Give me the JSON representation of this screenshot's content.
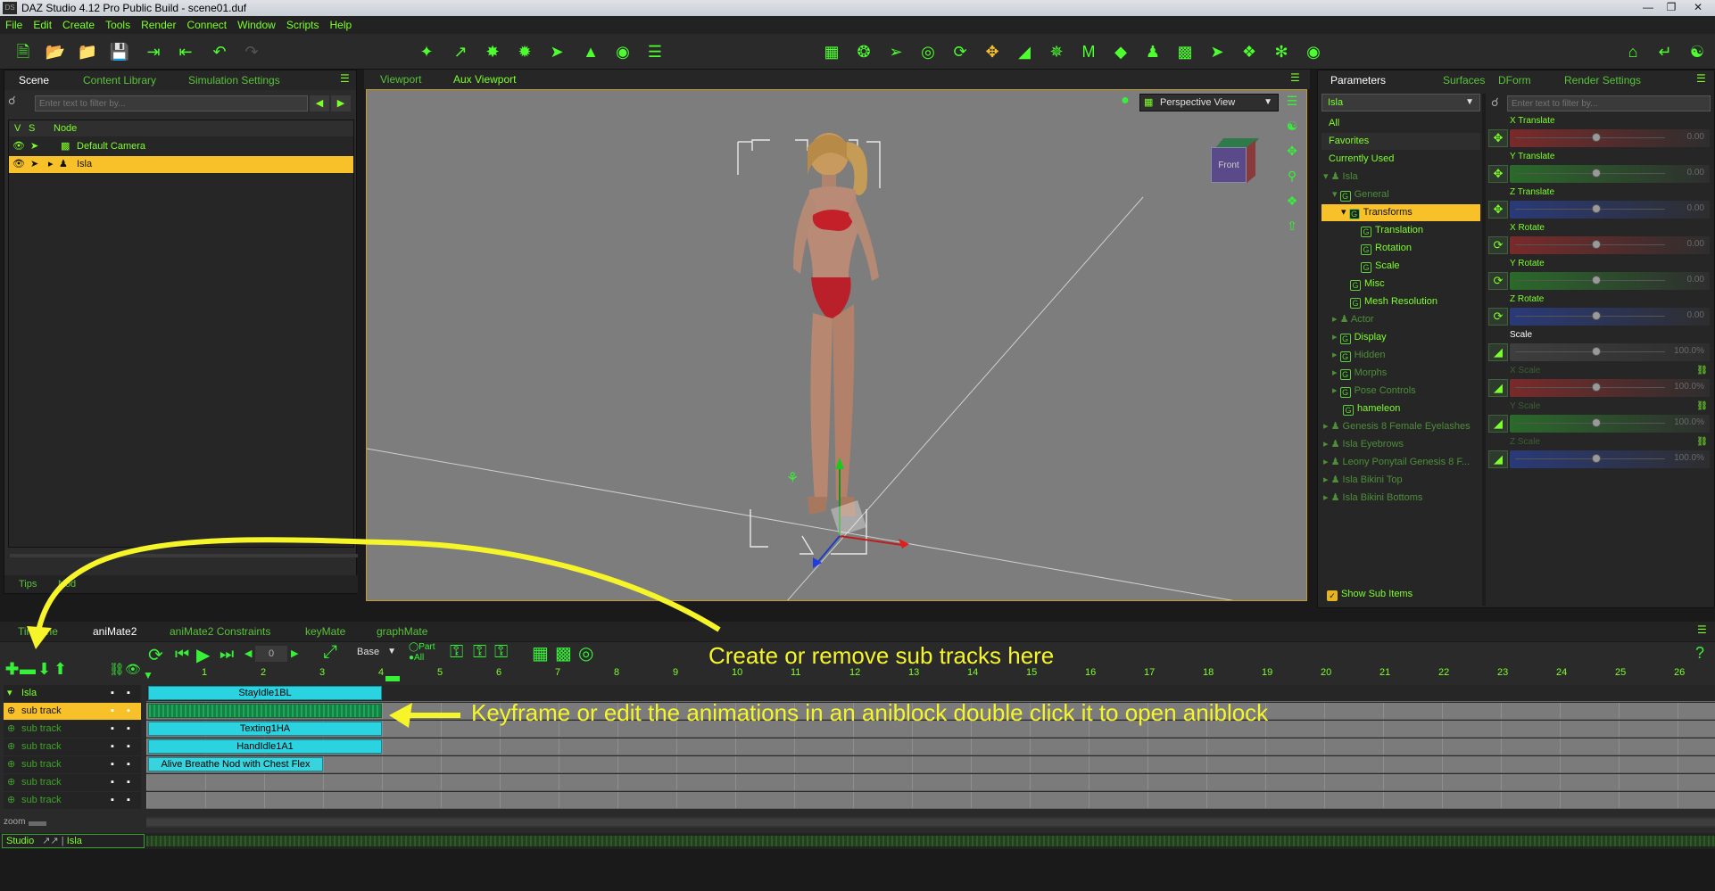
{
  "title": "DAZ Studio 4.12 Pro Public Build - scene01.duf",
  "app_icon": "DS",
  "window_controls": [
    "minimize-icon",
    "restore-icon",
    "close-icon"
  ],
  "menu": [
    "File",
    "Edit",
    "Create",
    "Tools",
    "Render",
    "Connect",
    "Window",
    "Scripts",
    "Help"
  ],
  "colors": {
    "accent": "#7dff2a",
    "selection": "#f8c12a",
    "aniblock": "#2bd3e0",
    "annotation": "#f5f52a",
    "viewport_bg": "#7d7d7d"
  },
  "scene": {
    "tabs": [
      "Scene",
      "Content Library",
      "Simulation Settings"
    ],
    "filter_placeholder": "Enter text to filter by...",
    "columns": [
      "V",
      "S",
      "Node"
    ],
    "nodes": [
      "Default Camera",
      "Isla"
    ],
    "bottom_tabs": [
      "Tips",
      "Nod"
    ]
  },
  "viewport": {
    "tabs": [
      "Viewport",
      "Aux Viewport"
    ],
    "view_select": "Perspective View",
    "cube_label": "Front"
  },
  "parameters": {
    "tabs": [
      "Parameters",
      "Surfaces",
      "DForm",
      "Render Settings"
    ],
    "node_select": "Isla",
    "filter_placeholder": "Enter text to filter by...",
    "groups": [
      "All",
      "Favorites",
      "Currently Used"
    ],
    "tree": [
      "Isla",
      "General",
      "Transforms",
      "Translation",
      "Rotation",
      "Scale",
      "Misc",
      "Mesh Resolution",
      "Actor",
      "Display",
      "Hidden",
      "Morphs",
      "Pose Controls",
      "hameleon",
      "Genesis 8 Female Eyelashes",
      "Isla Eyebrows",
      "Leony Ponytail Genesis 8 F...",
      "Isla Bikini Top",
      "Isla Bikini Bottoms"
    ],
    "show_sub_items": "Show Sub Items",
    "sliders": [
      {
        "label": "X Translate",
        "value": "0.00"
      },
      {
        "label": "Y Translate",
        "value": "0.00"
      },
      {
        "label": "Z Translate",
        "value": "0.00"
      },
      {
        "label": "X Rotate",
        "value": "0.00"
      },
      {
        "label": "Y Rotate",
        "value": "0.00"
      },
      {
        "label": "Z Rotate",
        "value": "0.00"
      },
      {
        "label": "Scale",
        "value": "100.0%"
      },
      {
        "label": "X Scale",
        "value": "100.0%"
      },
      {
        "label": "Y Scale",
        "value": "100.0%"
      },
      {
        "label": "Z Scale",
        "value": "100.0%"
      }
    ]
  },
  "animate": {
    "tabs": [
      "Timeline",
      "aniMate2",
      "aniMate2 Constraints",
      "keyMate",
      "graphMate"
    ],
    "frame_value": "0",
    "layer_select": "Base",
    "part_label": "Part",
    "all_label": "All",
    "ruler": [
      "1",
      "2",
      "3",
      "4",
      "5",
      "6",
      "7",
      "8",
      "9",
      "10",
      "11",
      "12",
      "13",
      "14",
      "15",
      "16",
      "17",
      "18",
      "19",
      "20",
      "21",
      "22",
      "23",
      "24",
      "25",
      "26"
    ],
    "tracks": [
      "Isla",
      "sub track",
      "sub track",
      "sub track",
      "sub track",
      "sub track",
      "sub track"
    ],
    "blocks": [
      "StayIdle1BL",
      "Texting1HA",
      "HandIdle1A1",
      "Alive Breathe Nod with Chest Flex"
    ],
    "zoom_label": "zoom",
    "help": "?"
  },
  "annotations": {
    "subtracks": "Create or remove sub tracks here",
    "aniblock": "Keyframe or edit the animations in an aniblock double click it to open aniblock"
  },
  "statusbar": {
    "left": "Studio",
    "node": "Isla"
  }
}
